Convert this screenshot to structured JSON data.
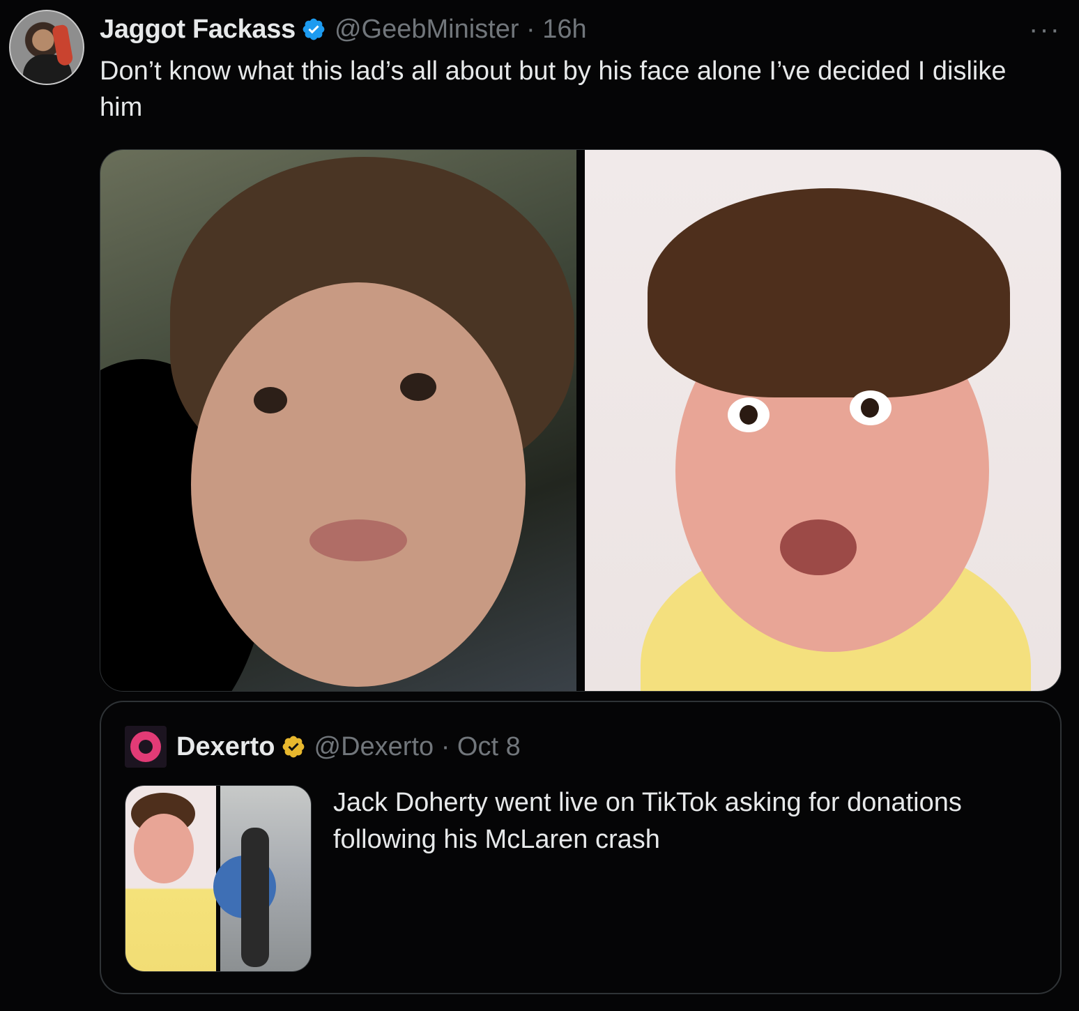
{
  "tweet": {
    "display_name": "Jaggot Fackass",
    "handle_time": "@GeebMinister · 16h",
    "text": "Don’t know what this lad’s all about but by his face alone I’ve decided I dislike him",
    "more_label": "···",
    "verified_color": "#1d9bf0"
  },
  "quoted": {
    "display_name": "Dexerto",
    "handle_time": "@Dexerto · Oct 8",
    "text": "Jack Doherty went live on TikTok asking for donations following his McLaren crash",
    "verified_color": "#e8b82e"
  }
}
